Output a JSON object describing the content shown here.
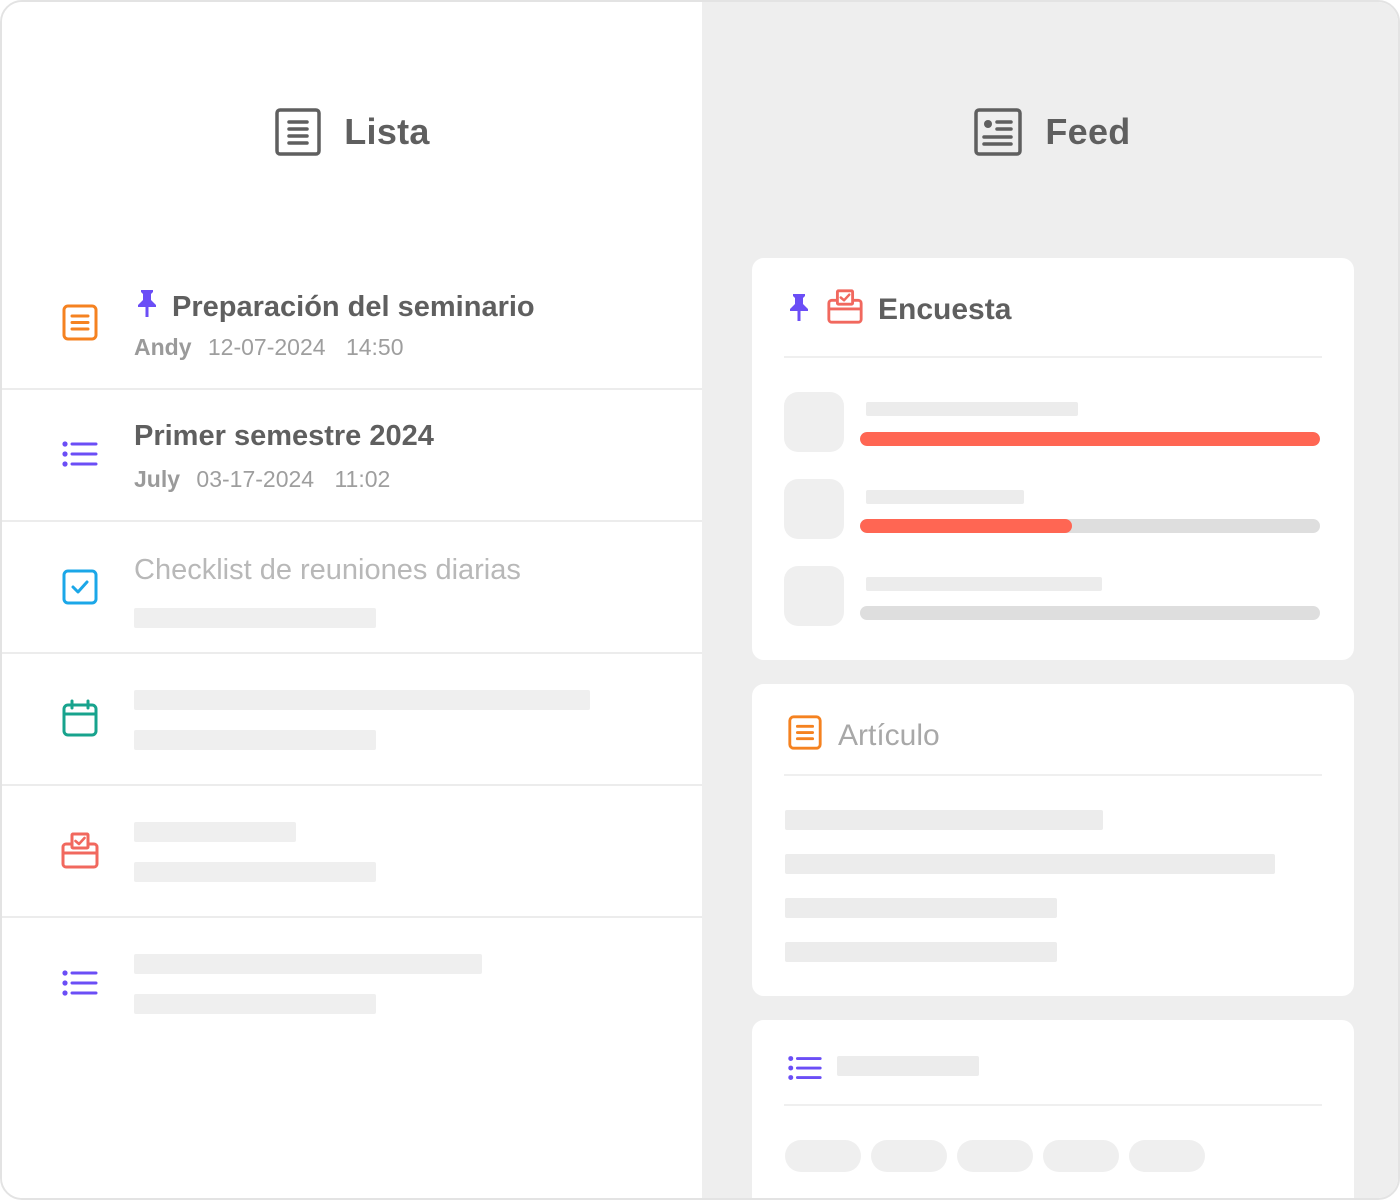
{
  "colors": {
    "accent_purple": "#6b4ef6",
    "accent_orange": "#f58220",
    "accent_blue": "#1ba7e8",
    "accent_teal": "#17a38d",
    "accent_red": "#f1685e",
    "poll_fill": "#ff6653"
  },
  "list_view": {
    "title": "Lista",
    "icon": "list-doc-icon",
    "items": [
      {
        "icon": "article-icon",
        "pinned": true,
        "title": "Preparación del seminario",
        "author": "Andy",
        "date": "12-07-2024",
        "time": "14:50"
      },
      {
        "icon": "bullet-list-icon",
        "pinned": false,
        "title": "Primer semestre 2024",
        "author": "July",
        "date": "03-17-2024",
        "time": "11:02"
      },
      {
        "icon": "checkbox-icon",
        "pinned": false,
        "title": "Checklist de reuniones diarias"
      },
      {
        "icon": "calendar-icon",
        "pinned": false
      },
      {
        "icon": "survey-icon",
        "pinned": false
      },
      {
        "icon": "bullet-list-icon",
        "pinned": false
      }
    ]
  },
  "feed_view": {
    "title": "Feed",
    "icon": "feed-doc-icon",
    "cards": [
      {
        "type": "survey",
        "icon": "survey-icon",
        "pinned": true,
        "label": "Encuesta",
        "poll_levels": [
          1.0,
          0.46,
          0.0
        ]
      },
      {
        "type": "article",
        "icon": "article-icon",
        "pinned": false,
        "label": "Artículo"
      },
      {
        "type": "list",
        "icon": "bullet-list-icon",
        "pinned": false,
        "label": ""
      }
    ]
  }
}
